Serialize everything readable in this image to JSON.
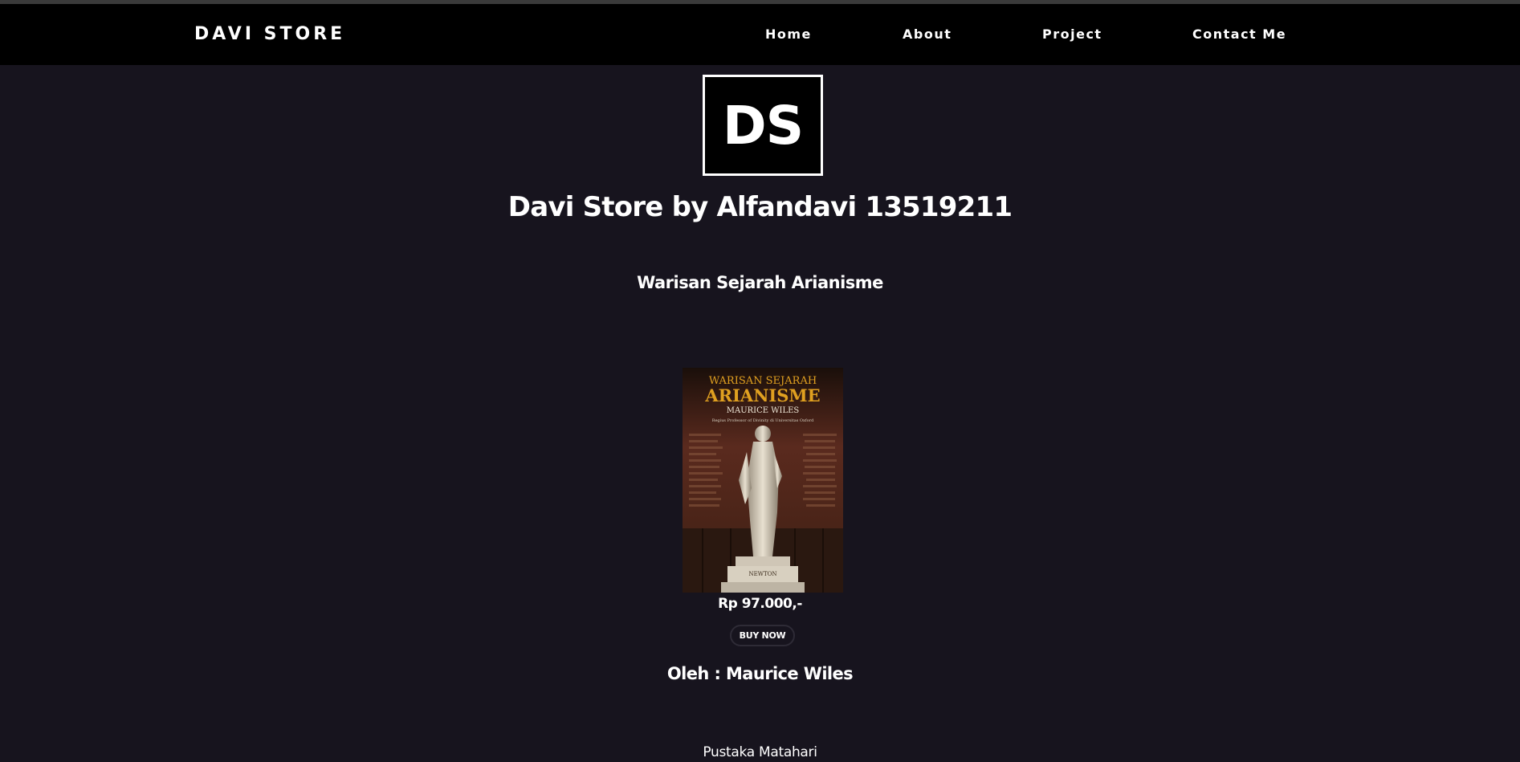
{
  "navbar": {
    "brand": "DAVI STORE",
    "items": [
      {
        "label": "Home"
      },
      {
        "label": "About"
      },
      {
        "label": "Project"
      },
      {
        "label": "Contact Me"
      }
    ]
  },
  "logo": {
    "text": "DS"
  },
  "site_title": "Davi Store by Alfandavi 13519211",
  "product": {
    "title": "Warisan Sejarah Arianisme",
    "cover": {
      "top_text": "WARISAN SEJARAH",
      "main_text": "ARIANISME",
      "author_text": "MAURICE WILES",
      "subtitle_text": "Regius Professor of Divinity di Universitas Oxford",
      "plaque_text": "NEWTON"
    },
    "price": "Rp 97.000,-",
    "buy_label": "BUY NOW",
    "author_line": "Oleh : Maurice Wiles",
    "publisher": "Pustaka Matahari"
  },
  "colors": {
    "page_bg": "#17141e",
    "navbar_bg": "#000000",
    "text": "#ffffff",
    "cover_accent": "#e0a020"
  }
}
